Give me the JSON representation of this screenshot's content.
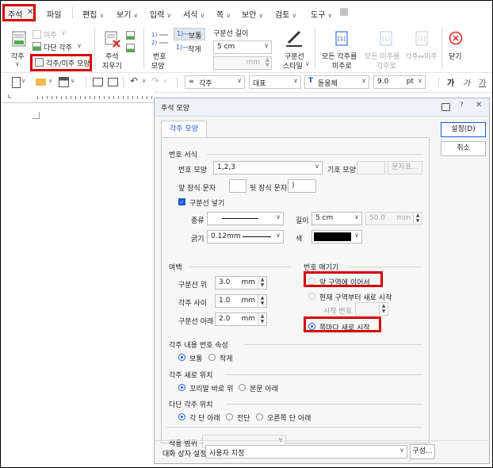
{
  "menubar": {
    "active_tab": "주석",
    "close_glyph": "✕",
    "items": [
      "파일",
      "편집",
      "보기",
      "입력",
      "서식",
      "쪽",
      "보안",
      "검토",
      "도구"
    ]
  },
  "ribbon": {
    "footnote": "각주",
    "endnote": "미주",
    "multilevel_footnote": "다단 각주",
    "footnote_endnote_shape": "각주/미주 모양",
    "delete_note_1": "주석",
    "delete_note_2": "지우기",
    "numbering_1": "번호",
    "numbering_2": "모양",
    "style_normal": "보통",
    "style_superscript": "작게",
    "separator_length": "구분선 길이",
    "separator_length_value": "5 cm",
    "separator_unit": "mm",
    "separator_style_1": "구분선",
    "separator_style_2": "스타일",
    "convert_all_to_endnote_1": "모든 각주를",
    "convert_all_to_endnote_2": "미주로",
    "convert_all_to_footnote_1": "모든 미주를",
    "convert_all_to_footnote_2": "각주로",
    "swap_notes": "각주↔미주",
    "close": "닫기"
  },
  "toolbar": {
    "style": "각주",
    "font_group": "대표",
    "font": "돋움체",
    "size": "9.0",
    "size_unit": "pt",
    "bold": "가",
    "italic": "가",
    "underline": "가"
  },
  "dialog": {
    "title": "주석 모양",
    "help": "?",
    "tab": "각주 모양",
    "ok": "설정(D)",
    "cancel": "취소",
    "number_format": {
      "section": "번호 서식",
      "shape_label": "번호 모양",
      "shape_value": "1,2,3",
      "symbol_label": "기호 모양",
      "char_button": "문자표...",
      "prefix_label": "앞 장식 문자",
      "prefix_value": "",
      "suffix_label": "뒷 장식 문자",
      "suffix_value": ")"
    },
    "separator": {
      "checkbox": "구분선 넣기",
      "type_label": "종류",
      "length_label": "길이",
      "length_value": "5 cm",
      "length_disabled_value": "50.0",
      "length_disabled_unit": "mm",
      "thickness_label": "굵기",
      "thickness_value": "0.12mm",
      "color_label": "색",
      "color_value": "#000000"
    },
    "margin": {
      "section": "여백",
      "above_label": "구분선 위",
      "above_value": "3.0",
      "between_label": "각주 사이",
      "between_value": "1.0",
      "below_label": "구분선 아래",
      "below_value": "2.0",
      "unit": "mm"
    },
    "numbering": {
      "section": "번호 매기기",
      "continue": "앞 구역에 이어서",
      "restart_section": "현재 구역부터 새로 시작",
      "start_number_label": "시작 번호",
      "restart_page": "쪽마다 새로 시작"
    },
    "content_number": {
      "section": "각주 내용 번호 속성",
      "normal": "보통",
      "small": "작게"
    },
    "position": {
      "section": "각주 새로 위치",
      "tail": "꼬리말 바로 위",
      "below_text": "본문 아래"
    },
    "multi_column": {
      "section": "다단 각주 위치",
      "each_column": "각 단 아래",
      "span_all": "전단",
      "right_column": "오른쪽 단 아래"
    },
    "apply_scope_label": "적용 범위",
    "dialog_settings_label": "대화 상자 설정",
    "dialog_settings_value": "사용자 지정",
    "config_button": "구성...",
    "colors": {
      "accent": "#1a56d6",
      "highlight": "#d40000"
    }
  }
}
